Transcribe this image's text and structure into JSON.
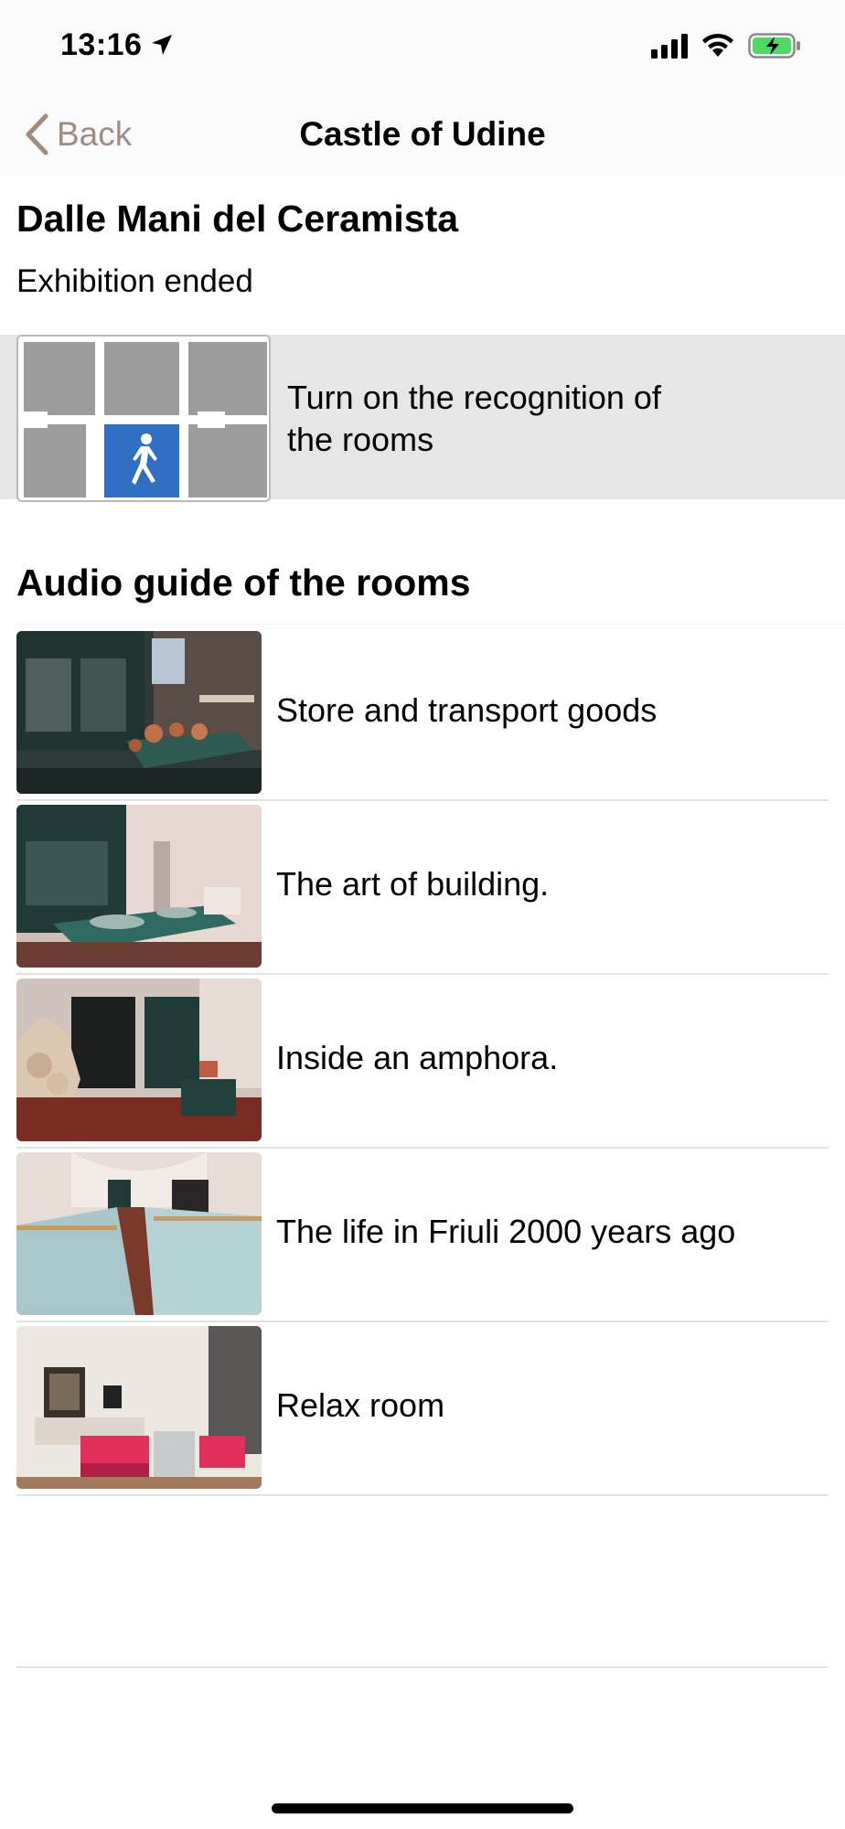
{
  "status_bar": {
    "time": "13:16",
    "icons": [
      "location-arrow-icon",
      "cellular-signal-icon",
      "wifi-icon",
      "battery-charging-icon"
    ],
    "battery_color": "#4cd964"
  },
  "nav": {
    "back_label": "Back",
    "title": "Castle of Udine",
    "accent_color": "#a08c80"
  },
  "exhibition": {
    "title": "Dalle Mani del Ceramista",
    "status": "Exhibition ended"
  },
  "recognition": {
    "line1": "Turn on the recognition of",
    "line2": "the rooms",
    "icon": "walking-person-icon",
    "icon_color": "#2f6fc4"
  },
  "audio_guide": {
    "title": "Audio guide of the rooms",
    "rooms": [
      {
        "label": "Store and transport goods"
      },
      {
        "label": "The art of building."
      },
      {
        "label": "Inside an amphora."
      },
      {
        "label": "The life in Friuli 2000 years ago"
      },
      {
        "label": "Relax room"
      }
    ]
  }
}
